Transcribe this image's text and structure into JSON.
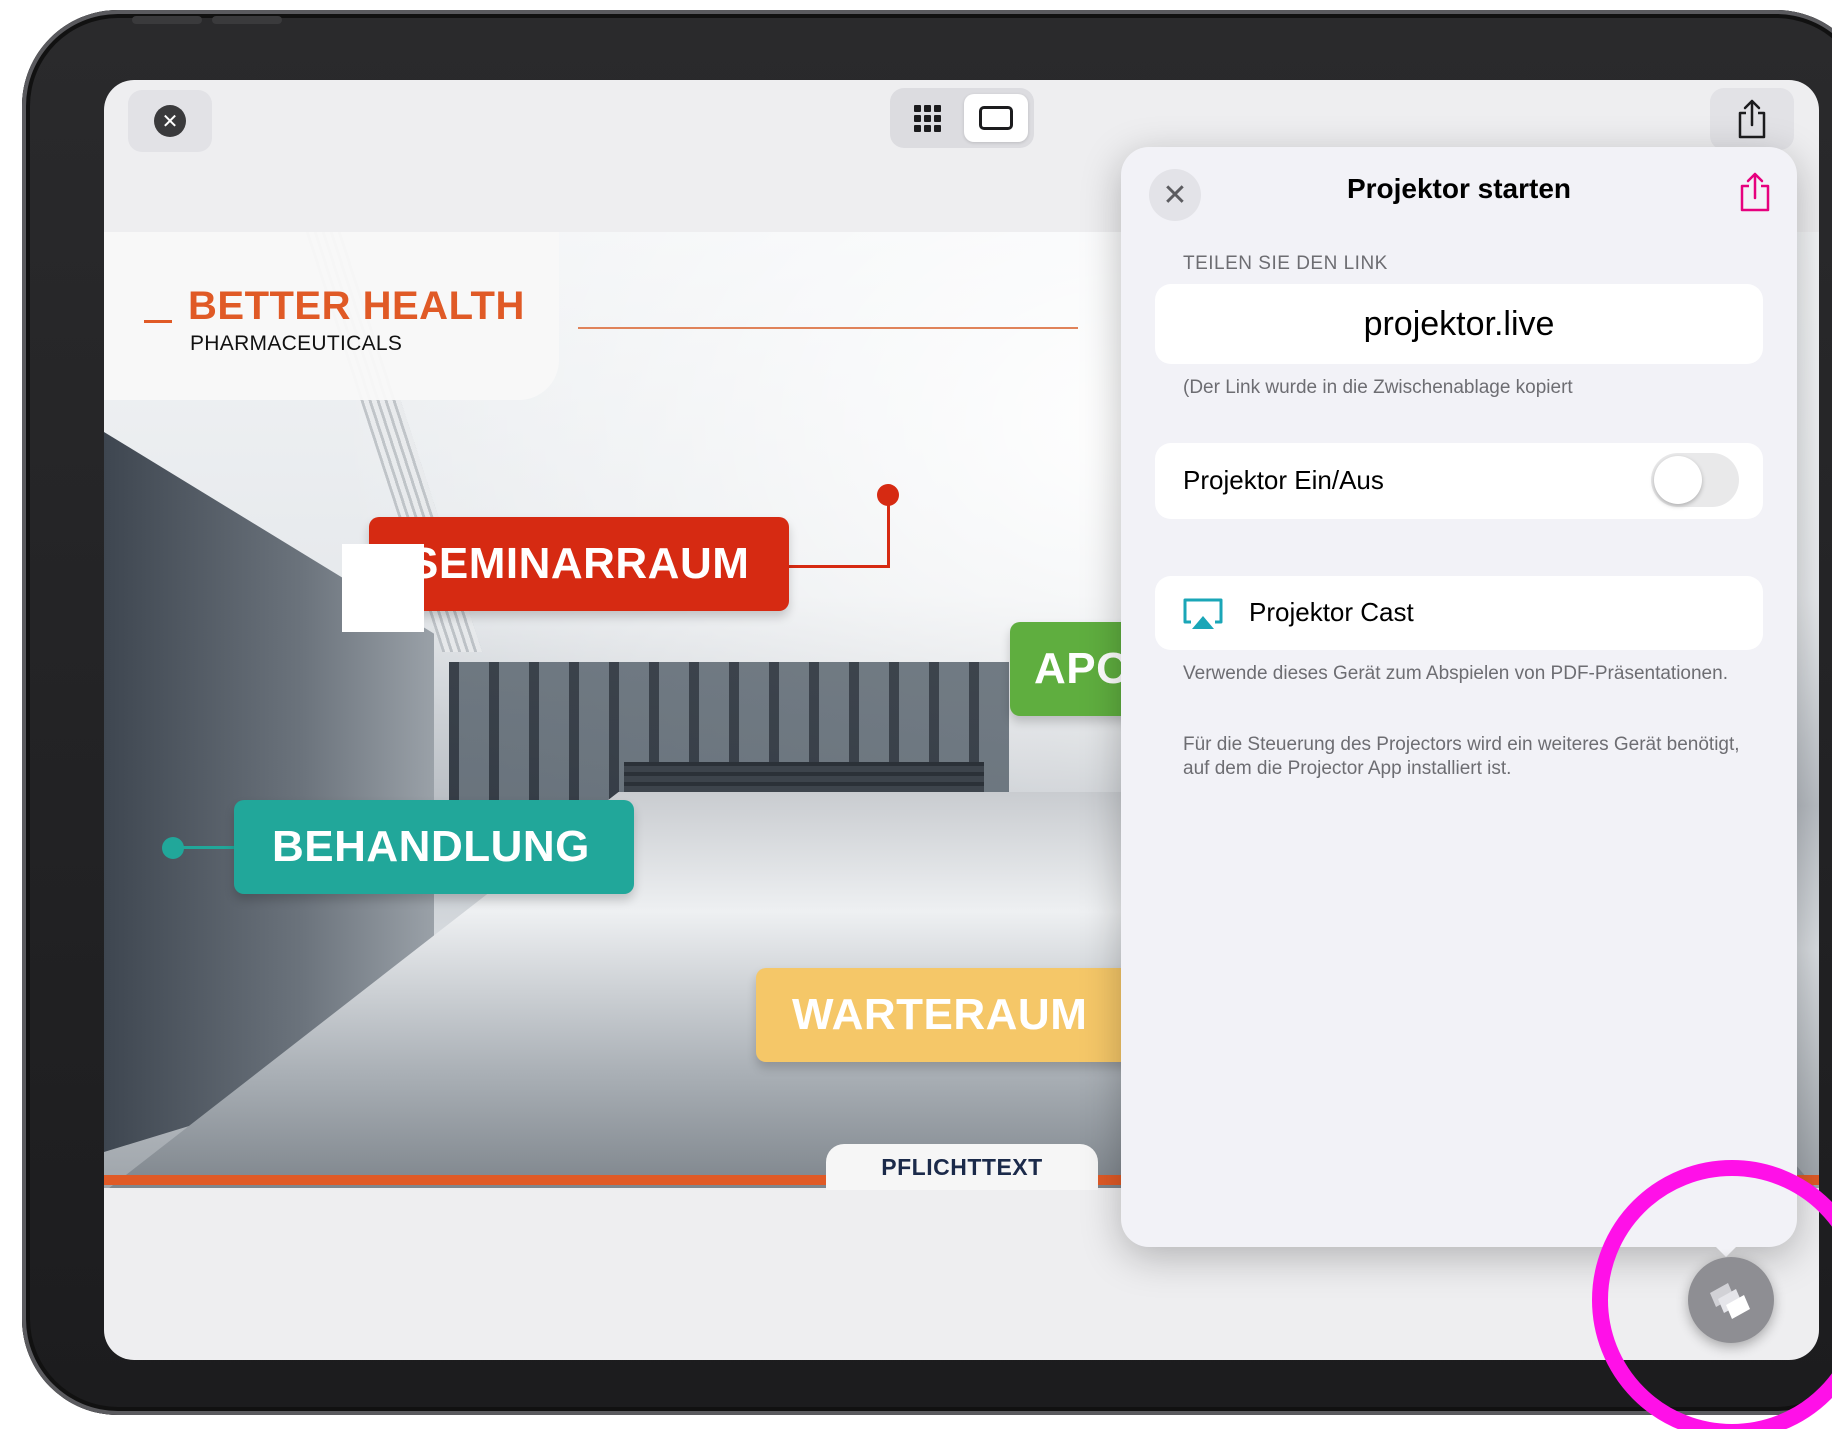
{
  "toolbar": {
    "close_icon": "close-circle-icon",
    "view_modes": [
      "grid-icon",
      "single-slide-icon"
    ],
    "share_icon": "share-icon"
  },
  "slide": {
    "logo_title": "BETTER HEALTH",
    "logo_subtitle": "PHARMACEUTICALS",
    "labels": {
      "seminar": "SEMINARRAUM",
      "apo": "APO",
      "behandlung": "BEHANDLUNG",
      "warteraum": "WARTERAUM"
    },
    "footer_tab": "PFLICHTTEXT",
    "colors": {
      "seminar": "#d62a12",
      "apo": "#5fae3f",
      "behandlung": "#21a79a",
      "warteraum": "#f5c768",
      "brand": "#e05a26"
    }
  },
  "panel": {
    "title": "Projektor starten",
    "section_header": "TEILEN SIE DEN LINK",
    "link": "projektor.live",
    "link_note": "(Der Link wurde in die Zwischenablage kopiert",
    "toggle_label": "Projektor Ein/Aus",
    "toggle_on": false,
    "cast_label": "Projektor Cast",
    "desc1": "Verwende dieses Gerät zum Abspielen von PDF-Präsentationen.",
    "desc2": "Für die Steuerung des Projectors wird ein weiteres Gerät benötigt, auf dem die Projector App installiert ist.",
    "accent_color": "#e6007e",
    "cast_color": "#1aa6b7"
  },
  "fab": {
    "icon": "projector-slides-icon",
    "highlight_color": "#ff10e8"
  }
}
